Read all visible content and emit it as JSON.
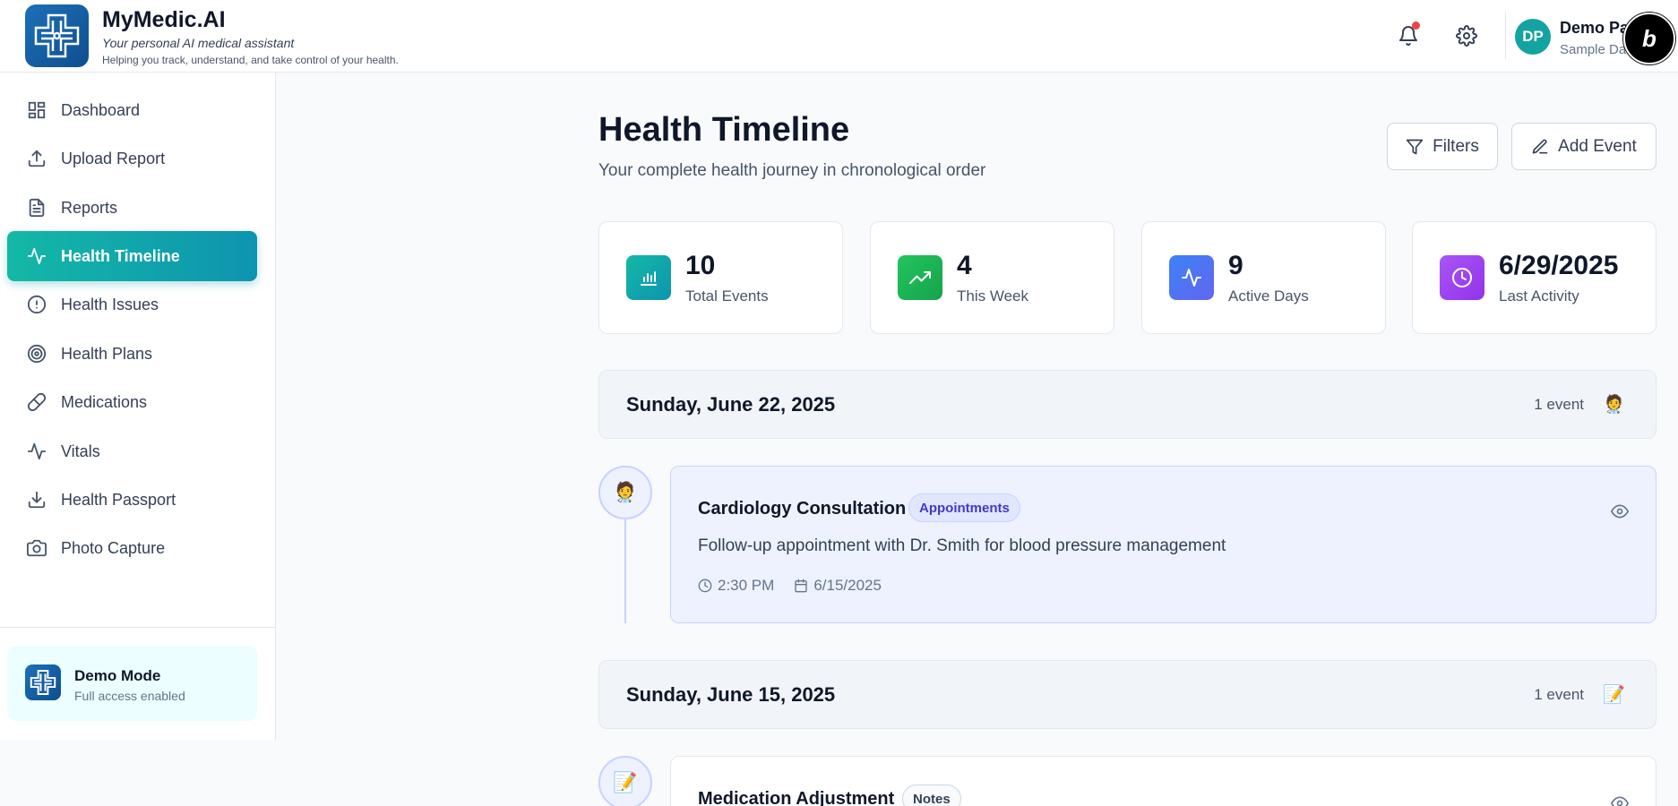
{
  "app": {
    "name": "MyMedic.AI",
    "tagline": "Your personal AI medical assistant",
    "subtagline": "Helping you track, understand, and take control of your health."
  },
  "user": {
    "initials": "DP",
    "name": "Demo Pa",
    "subtitle": "Sample Da"
  },
  "badge": {
    "label": "b"
  },
  "sidebar": {
    "items": [
      {
        "label": "Dashboard",
        "icon": "dashboard-icon"
      },
      {
        "label": "Upload Report",
        "icon": "upload-icon"
      },
      {
        "label": "Reports",
        "icon": "document-icon"
      },
      {
        "label": "Health Timeline",
        "icon": "activity-icon",
        "active": true
      },
      {
        "label": "Health Issues",
        "icon": "alert-circle-icon"
      },
      {
        "label": "Health Plans",
        "icon": "target-icon"
      },
      {
        "label": "Medications",
        "icon": "pill-icon"
      },
      {
        "label": "Vitals",
        "icon": "pulse-icon"
      },
      {
        "label": "Health Passport",
        "icon": "download-icon"
      },
      {
        "label": "Photo Capture",
        "icon": "camera-icon"
      }
    ],
    "demo": {
      "title": "Demo Mode",
      "subtitle": "Full access enabled"
    }
  },
  "main": {
    "title": "Health Timeline",
    "subtitle": "Your complete health journey in chronological order",
    "filters_label": "Filters",
    "add_event_label": "Add Event",
    "stats": [
      {
        "value": "10",
        "label": "Total Events",
        "color": "#14b8a6",
        "icon": "bar-chart-icon"
      },
      {
        "value": "4",
        "label": "This Week",
        "color": "#22c55e",
        "icon": "trending-up-icon"
      },
      {
        "value": "9",
        "label": "Active Days",
        "color": "#6366f1",
        "icon": "activity-icon"
      },
      {
        "value": "6/29/2025",
        "label": "Last Activity",
        "color": "#a855f7",
        "icon": "clock-icon"
      }
    ],
    "groups": [
      {
        "date": "Sunday, June 22, 2025",
        "count": "1 event",
        "emoji": "🧑‍⚕️",
        "event": {
          "title": "Cardiology Consultation",
          "badge": "Appointments",
          "description": "Follow-up appointment with Dr. Smith for blood pressure management",
          "time": "2:30 PM",
          "date": "6/15/2025"
        }
      },
      {
        "date": "Sunday, June 15, 2025",
        "count": "1 event",
        "emoji": "📝",
        "event": {
          "title": "Medication Adjustment",
          "badge": "Notes"
        }
      }
    ]
  }
}
